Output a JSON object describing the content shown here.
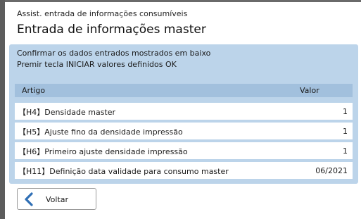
{
  "header": {
    "subtitle": "Assist. entrada de informações consumíveis",
    "title": "Entrada de informações master"
  },
  "instructions": {
    "line1": "Confirmar os dados entrados mostrados em baixo",
    "line2": "Premir tecla INICIAR valores definidos OK"
  },
  "table": {
    "columns": {
      "item": "Artigo",
      "value": "Valor"
    },
    "rows": [
      {
        "code": "【H4】",
        "label": "Densidade master",
        "value": "1"
      },
      {
        "code": "【H5】",
        "label": "Ajuste fino da densidade impressão",
        "value": "1"
      },
      {
        "code": "【H6】",
        "label": "Primeiro ajuste densidade impressão",
        "value": "1"
      },
      {
        "code": "【H11】",
        "label": "Definição data validade para consumo master",
        "value": "06/2021"
      }
    ]
  },
  "back_button": {
    "label": "Voltar",
    "icon": "chevron-left-icon",
    "icon_color": "#2f6fb5"
  },
  "colors": {
    "panel": "#bcd4ea",
    "table_header": "#a2c0dd",
    "accent": "#2f6fb5"
  }
}
